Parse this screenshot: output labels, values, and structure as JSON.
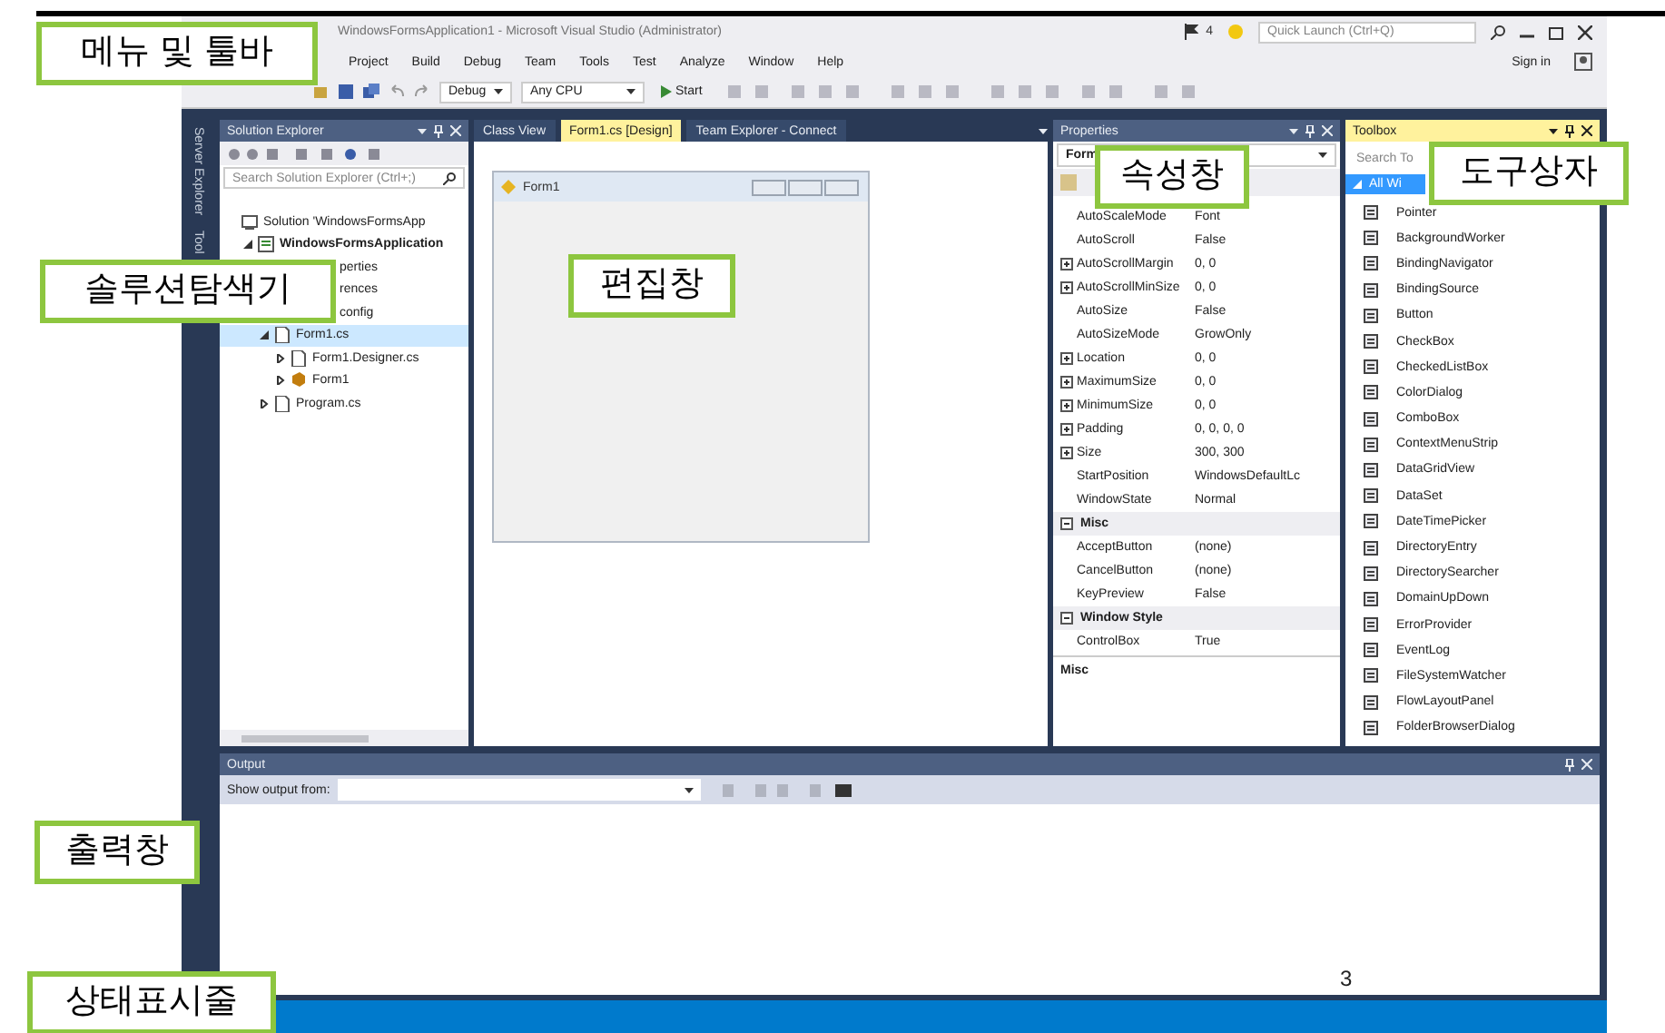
{
  "annotations": [
    {
      "text": "메뉴 및 툴바"
    },
    {
      "text": "솔루션탐색기"
    },
    {
      "text": "편집창"
    },
    {
      "text": "속성창"
    },
    {
      "text": "도구상자"
    },
    {
      "text": "출력창"
    },
    {
      "text": "상태표시줄"
    }
  ],
  "page_number": "3",
  "window": {
    "title": "WindowsFormsApplication1 - Microsoft Visual Studio (Administrator)",
    "notification_count": "4",
    "quick_launch": {
      "placeholder": "Quick Launch (Ctrl+Q)"
    },
    "sign_in": "Sign in"
  },
  "menu": [
    "Project",
    "Build",
    "Debug",
    "Team",
    "Tools",
    "Test",
    "Analyze",
    "Window",
    "Help"
  ],
  "toolbar": {
    "configuration": "Debug",
    "platform": "Any CPU",
    "start": "Start"
  },
  "side_tabs": [
    "Server Explorer",
    "Tool"
  ],
  "solution_explorer": {
    "title": "Solution Explorer",
    "search": {
      "placeholder": "Search Solution Explorer (Ctrl+;)"
    },
    "tree": [
      {
        "kind": "solution",
        "label": "Solution 'WindowsFormsApp",
        "selected": false,
        "children": [
          {
            "kind": "project",
            "label": "WindowsFormsApplication",
            "selected": false,
            "expanded": true,
            "children": [
              {
                "kind": "folder",
                "label": "perties",
                "selected": false,
                "cut": true
              },
              {
                "kind": "folder",
                "label": "rences",
                "selected": false,
                "cut": true
              },
              {
                "kind": "file",
                "label": "config",
                "selected": false,
                "cut": true
              },
              {
                "kind": "file",
                "label": "Form1.cs",
                "selected": true,
                "expanded": true,
                "children": [
                  {
                    "kind": "file",
                    "label": "Form1.Designer.cs",
                    "selected": false,
                    "expanded": false
                  },
                  {
                    "kind": "class",
                    "label": "Form1",
                    "selected": false,
                    "expanded": false
                  }
                ]
              },
              {
                "kind": "file",
                "label": "Program.cs",
                "selected": false,
                "expanded": false
              }
            ]
          }
        ]
      }
    ]
  },
  "editor": {
    "tabs": [
      {
        "label": "Class View",
        "selected": false
      },
      {
        "label": "Form1.cs [Design]",
        "selected": true
      },
      {
        "label": "Team Explorer - Connect",
        "selected": false
      }
    ],
    "form": {
      "title": "Form1"
    }
  },
  "properties": {
    "title": "Properties",
    "object": "Form",
    "rows": [
      {
        "kind": "property",
        "name": "AutoScaleMode",
        "value": "Font",
        "expandable": false
      },
      {
        "kind": "property",
        "name": "AutoScroll",
        "value": "False",
        "expandable": false
      },
      {
        "kind": "property",
        "name": "AutoScrollMargin",
        "value": "0, 0",
        "expandable": true
      },
      {
        "kind": "property",
        "name": "AutoScrollMinSize",
        "value": "0, 0",
        "expandable": true
      },
      {
        "kind": "property",
        "name": "AutoSize",
        "value": "False",
        "expandable": false
      },
      {
        "kind": "property",
        "name": "AutoSizeMode",
        "value": "GrowOnly",
        "expandable": false
      },
      {
        "kind": "property",
        "name": "Location",
        "value": "0, 0",
        "expandable": true
      },
      {
        "kind": "property",
        "name": "MaximumSize",
        "value": "0, 0",
        "expandable": true
      },
      {
        "kind": "property",
        "name": "MinimumSize",
        "value": "0, 0",
        "expandable": true
      },
      {
        "kind": "property",
        "name": "Padding",
        "value": "0, 0, 0, 0",
        "expandable": true
      },
      {
        "kind": "property",
        "name": "Size",
        "value": "300, 300",
        "expandable": true
      },
      {
        "kind": "property",
        "name": "StartPosition",
        "value": "WindowsDefaultLc",
        "expandable": false
      },
      {
        "kind": "property",
        "name": "WindowState",
        "value": "Normal",
        "expandable": false
      },
      {
        "kind": "category",
        "name": "Misc"
      },
      {
        "kind": "property",
        "name": "AcceptButton",
        "value": "(none)",
        "expandable": false
      },
      {
        "kind": "property",
        "name": "CancelButton",
        "value": "(none)",
        "expandable": false
      },
      {
        "kind": "property",
        "name": "KeyPreview",
        "value": "False",
        "expandable": false
      },
      {
        "kind": "category",
        "name": "Window Style"
      },
      {
        "kind": "property",
        "name": "ControlBox",
        "value": "True",
        "expandable": false
      }
    ],
    "description": "Misc"
  },
  "toolbox": {
    "title": "Toolbox",
    "search": {
      "placeholder": "Search To"
    },
    "group": "All Wi",
    "items": [
      "Pointer",
      "BackgroundWorker",
      "BindingNavigator",
      "BindingSource",
      "Button",
      "CheckBox",
      "CheckedListBox",
      "ColorDialog",
      "ComboBox",
      "ContextMenuStrip",
      "DataGridView",
      "DataSet",
      "DateTimePicker",
      "DirectoryEntry",
      "DirectorySearcher",
      "DomainUpDown",
      "ErrorProvider",
      "EventLog",
      "FileSystemWatcher",
      "FlowLayoutPanel",
      "FolderBrowserDialog"
    ]
  },
  "output": {
    "title": "Output",
    "source_label": "Show output from:"
  }
}
